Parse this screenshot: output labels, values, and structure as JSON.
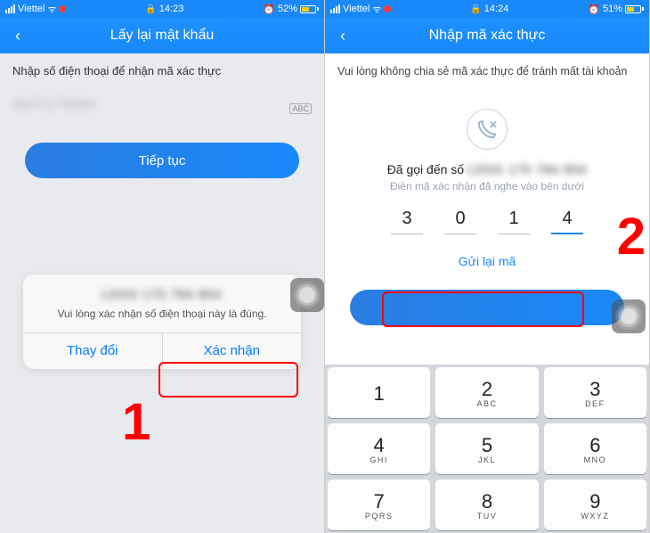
{
  "left": {
    "status": {
      "carrier": "Viettel",
      "time": "14:23",
      "battery": "52%"
    },
    "nav": {
      "title": "Lấy lại mật khẩu"
    },
    "instruction": "Nhập số điện thoại để nhận mã xác thực",
    "phone_blur": "SDT/175584",
    "abc": "ABC",
    "continue": "Tiếp tục",
    "modal": {
      "phone": "LDSS 175 784 854",
      "message": "Vui lòng xác nhận số điện thoại này là đúng.",
      "change": "Thay đổi",
      "confirm": "Xác nhận"
    },
    "badge": "1"
  },
  "right": {
    "status": {
      "carrier": "Viettel",
      "time": "14:24",
      "battery": "51%"
    },
    "nav": {
      "title": "Nhập mã xác thực"
    },
    "warning": "Vui lòng không chia sẻ mã xác thực để tránh mất tài khoản",
    "called_prefix": "Đã gọi đến số",
    "called_blur": "LDSS 175 784 854",
    "sub": "Điền mã xác nhận đã nghe vào bên dưới",
    "code": [
      "3",
      "0",
      "1",
      "4"
    ],
    "resend": "Gửi lại mã",
    "badge": "2",
    "keypad": [
      {
        "n": "1",
        "s": ""
      },
      {
        "n": "2",
        "s": "ABC"
      },
      {
        "n": "3",
        "s": "DEF"
      },
      {
        "n": "4",
        "s": "GHI"
      },
      {
        "n": "5",
        "s": "JKL"
      },
      {
        "n": "6",
        "s": "MNO"
      },
      {
        "n": "7",
        "s": "PQRS"
      },
      {
        "n": "8",
        "s": "TUV"
      },
      {
        "n": "9",
        "s": "WXYZ"
      }
    ]
  }
}
